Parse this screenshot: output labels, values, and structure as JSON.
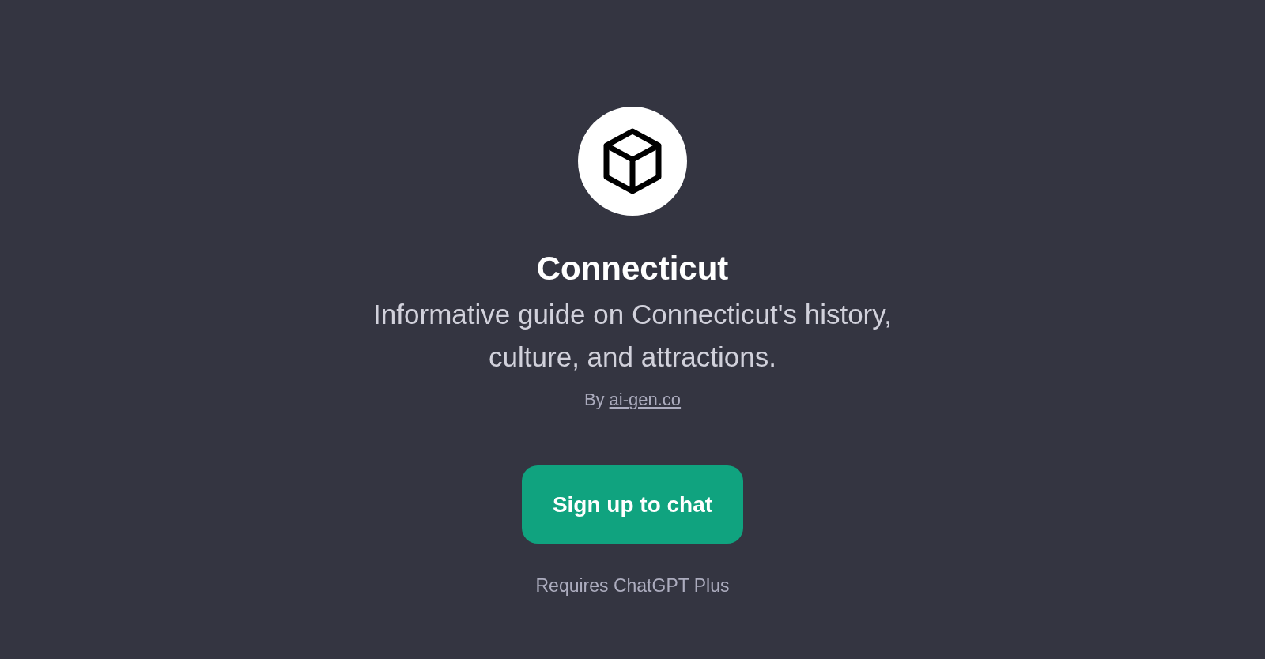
{
  "title": "Connecticut",
  "description": "Informative guide on Connecticut's history, culture, and attractions.",
  "byline": {
    "prefix": "By",
    "link": "ai-gen.co"
  },
  "button": "Sign up to chat",
  "footnote": "Requires ChatGPT Plus"
}
